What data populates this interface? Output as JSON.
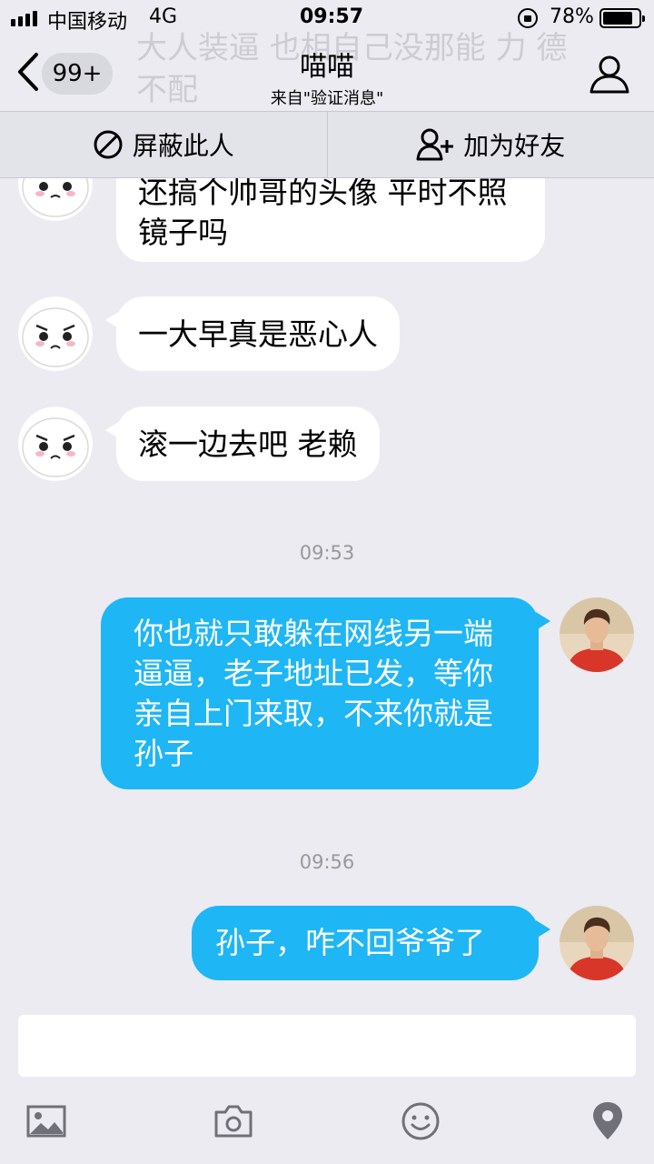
{
  "status_bar": {
    "carrier": "中国移动",
    "network": "4G",
    "time": "09:57",
    "battery": "78%"
  },
  "header": {
    "background_text": "大人装逼 也相自己没那能 力 德不配",
    "back_badge": "99+",
    "title": "喵喵",
    "subtitle": "来自\"验证消息\""
  },
  "actions": {
    "block": "屏蔽此人",
    "add_friend": "加为好友"
  },
  "messages": [
    {
      "side": "in",
      "text": "还搞个帅哥的头像 平时不照镜子吗"
    },
    {
      "side": "in",
      "text": "一大早真是恶心人"
    },
    {
      "side": "in",
      "text": "滚一边去吧 老赖"
    },
    {
      "side": "out",
      "time": "09:53",
      "text": "你也就只敢躲在网线另一端逼逼，老子地址已发，等你亲自上门来取，不来你就是孙子"
    },
    {
      "side": "out",
      "time": "09:56",
      "text": "孙子，咋不回爷爷了"
    }
  ],
  "colors": {
    "outgoing_bubble": "#1eb6f5",
    "incoming_bubble": "#ffffff",
    "background": "#ebebf1"
  },
  "toolbar": {
    "icons": [
      "image-icon",
      "camera-icon",
      "emoji-icon",
      "location-icon"
    ]
  }
}
